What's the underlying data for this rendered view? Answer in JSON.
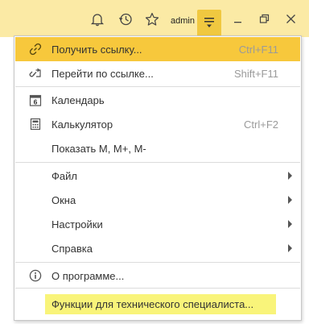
{
  "titlebar": {
    "user": "admin",
    "icons": [
      "bell-icon",
      "history-icon",
      "star-icon",
      "main-menu-icon",
      "minimize-icon",
      "restore-icon",
      "close-icon"
    ]
  },
  "menu": {
    "items": [
      {
        "label": "Получить ссылку...",
        "hotkey": "Ctrl+F11",
        "icon": "link-icon",
        "highlighted": true
      },
      {
        "label": "Перейти по ссылке...",
        "hotkey": "Shift+F11",
        "icon": "go-link-icon"
      },
      {
        "label": "Календарь",
        "icon": "calendar-icon",
        "icon_text": "6"
      },
      {
        "label": "Калькулятор",
        "hotkey": "Ctrl+F2",
        "icon": "calculator-icon"
      },
      {
        "label": "Показать M, M+, M-"
      },
      {
        "label": "Файл",
        "submenu": true
      },
      {
        "label": "Окна",
        "submenu": true
      },
      {
        "label": "Настройки",
        "submenu": true
      },
      {
        "label": "Справка",
        "submenu": true
      },
      {
        "label": "О программе...",
        "icon": "info-icon"
      },
      {
        "label": "Функции для технического специалиста...",
        "marked": true,
        "mark_color": "#f9f47a"
      }
    ]
  },
  "colors": {
    "titlebar": "#fbeaa5",
    "menu_button": "#f0c840",
    "highlight": "#f7c83c",
    "marker": "#f9f47a"
  }
}
